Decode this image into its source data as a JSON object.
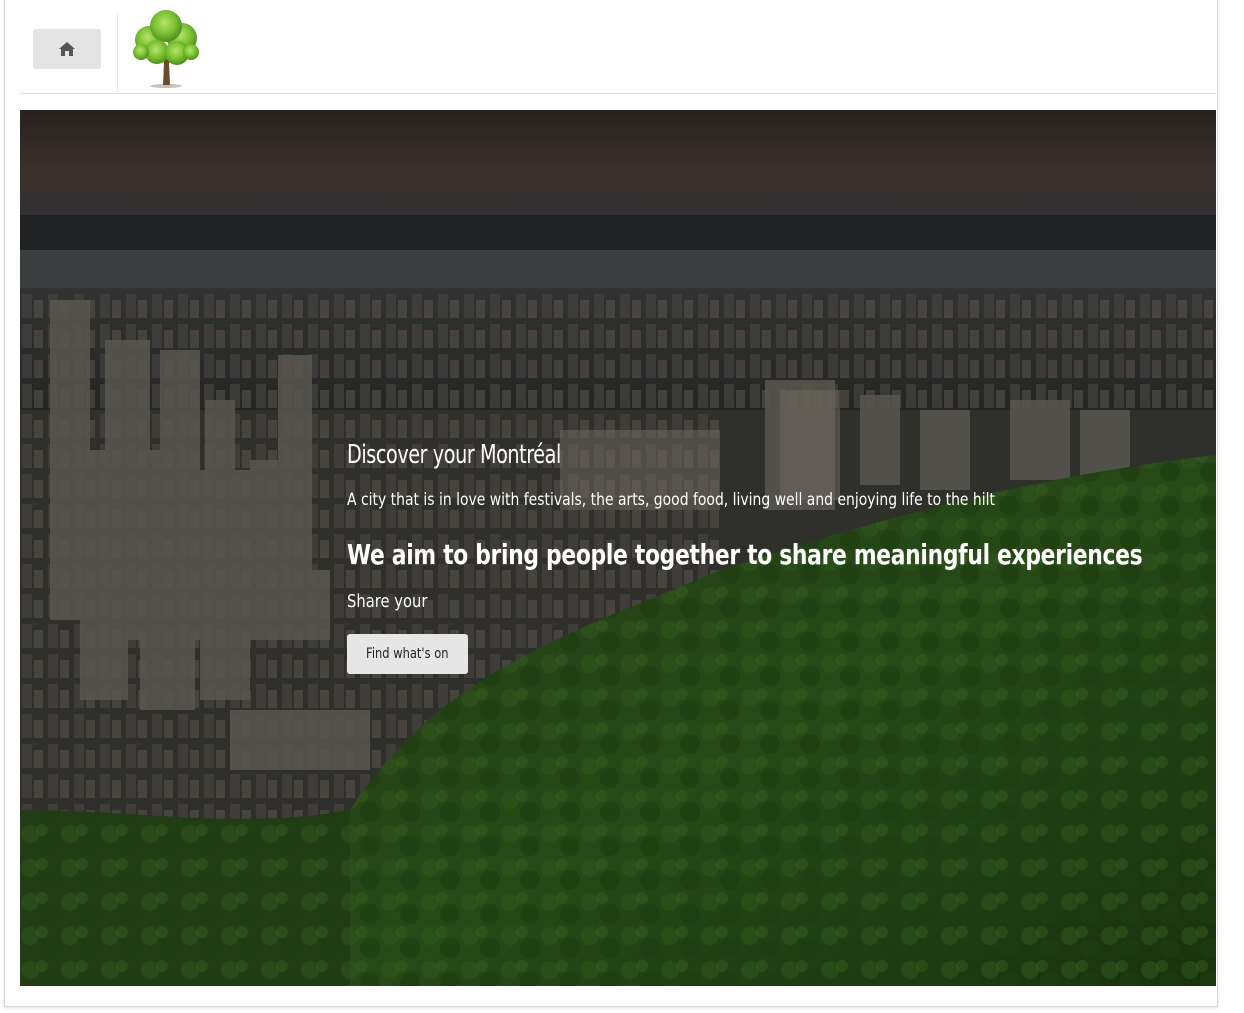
{
  "header": {
    "home_icon": "home-icon",
    "logo_icon": "tree-logo"
  },
  "hero": {
    "title": "Discover your Montréal",
    "tagline": "A city that is in love with festivals, the arts, good food, living well and enjoying life to the hilt",
    "mission": "We aim to bring people together to share meaningful experiences",
    "share_text": "Share your",
    "cta_label": "Find what's on"
  },
  "colors": {
    "header_button_bg": "#e4e4e4",
    "cta_bg": "#e6e6e6",
    "hero_text": "#ffffff",
    "forest_green": "#2f5a1d",
    "sky_dark": "#3a3330"
  }
}
